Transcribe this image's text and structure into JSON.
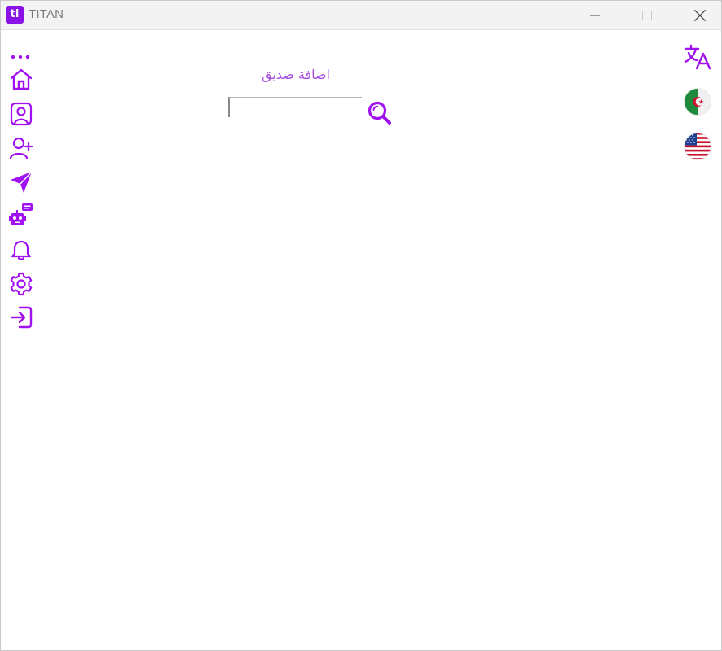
{
  "window": {
    "title": "TITAN",
    "app_icon_text": "ti"
  },
  "colors": {
    "accent": "#a110f0",
    "title_text": "#a64de0"
  },
  "sidebar": {
    "items": [
      {
        "icon": "more-dots-icon"
      },
      {
        "icon": "home-icon"
      },
      {
        "icon": "profile-icon"
      },
      {
        "icon": "add-user-icon"
      },
      {
        "icon": "send-icon"
      },
      {
        "icon": "chatbot-icon"
      },
      {
        "icon": "bell-icon"
      },
      {
        "icon": "gear-icon"
      },
      {
        "icon": "logout-icon"
      }
    ]
  },
  "language_panel": {
    "items": [
      {
        "icon": "translate-icon"
      },
      {
        "icon": "algeria-flag-icon"
      },
      {
        "icon": "usa-flag-icon"
      }
    ]
  },
  "main": {
    "title": "اضافة صديق",
    "search": {
      "value": "",
      "placeholder": ""
    }
  }
}
